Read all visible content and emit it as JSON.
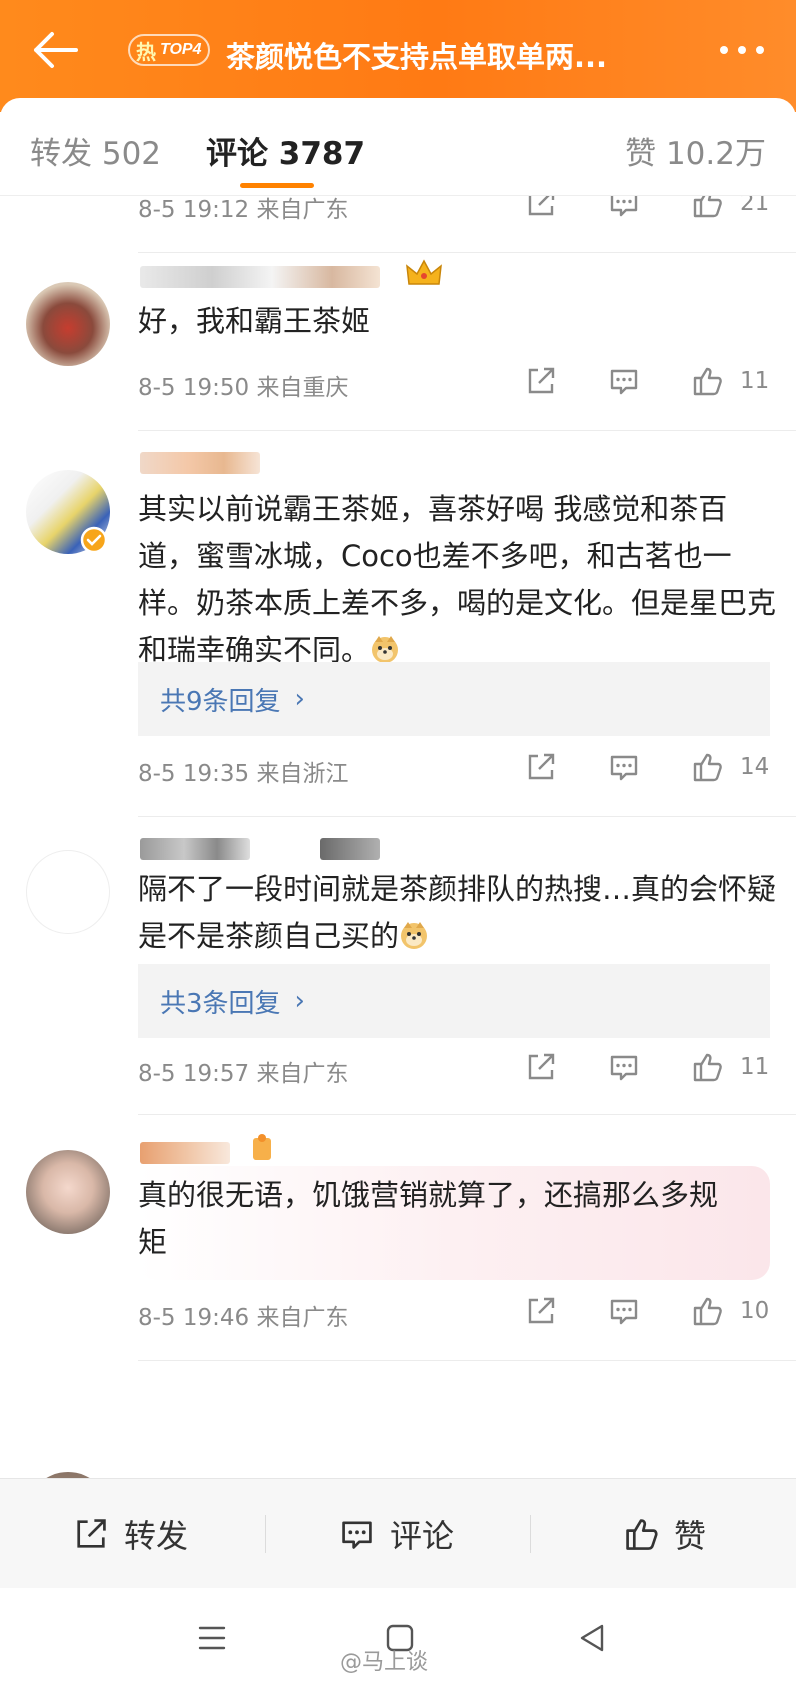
{
  "header": {
    "hot_char": "热",
    "hot_rank": "TOP4",
    "title": "茶颜悦色不支持点单取单两..."
  },
  "tabs": {
    "repost": "转发 502",
    "comment": "评论 3787",
    "like": "赞 10.2万"
  },
  "comments": [
    {
      "meta": "8-5 19:12 来自广东",
      "likes": "21"
    },
    {
      "text": "好，我和霸王茶姬",
      "meta": "8-5 19:50 来自重庆",
      "likes": "11"
    },
    {
      "text": "其实以前说霸王茶姬，喜茶好喝 我感觉和茶百道，蜜雪冰城，Coco也差不多吧，和古茗也一样。奶茶本质上差不多，喝的是文化。但是星巴克和瑞幸确实不同。",
      "replies": "共9条回复",
      "meta": "8-5 19:35 来自浙江",
      "likes": "14"
    },
    {
      "text": "隔不了一段时间就是茶颜排队的热搜…真的会怀疑是不是茶颜自己买的",
      "replies": "共3条回复",
      "meta": "8-5 19:57 来自广东",
      "likes": "11"
    },
    {
      "text": "真的很无语，饥饿营销就算了，还搞那么多规矩",
      "meta": "8-5 19:46 来自广东",
      "likes": "10"
    }
  ],
  "actionbar": {
    "repost": "转发",
    "comment": "评论",
    "like": "赞"
  },
  "watermark": "@马上谈",
  "colors": {
    "brand_orange": "#ff8200",
    "link_blue": "#4a77b4",
    "meta_gray": "#8a8a8a"
  },
  "icons": [
    "back-arrow-icon",
    "more-icon",
    "share-icon",
    "comment-icon",
    "thumbs-up-icon",
    "crown-icon",
    "verified-badge-icon",
    "doge-emoji-icon",
    "chevron-right-icon"
  ]
}
